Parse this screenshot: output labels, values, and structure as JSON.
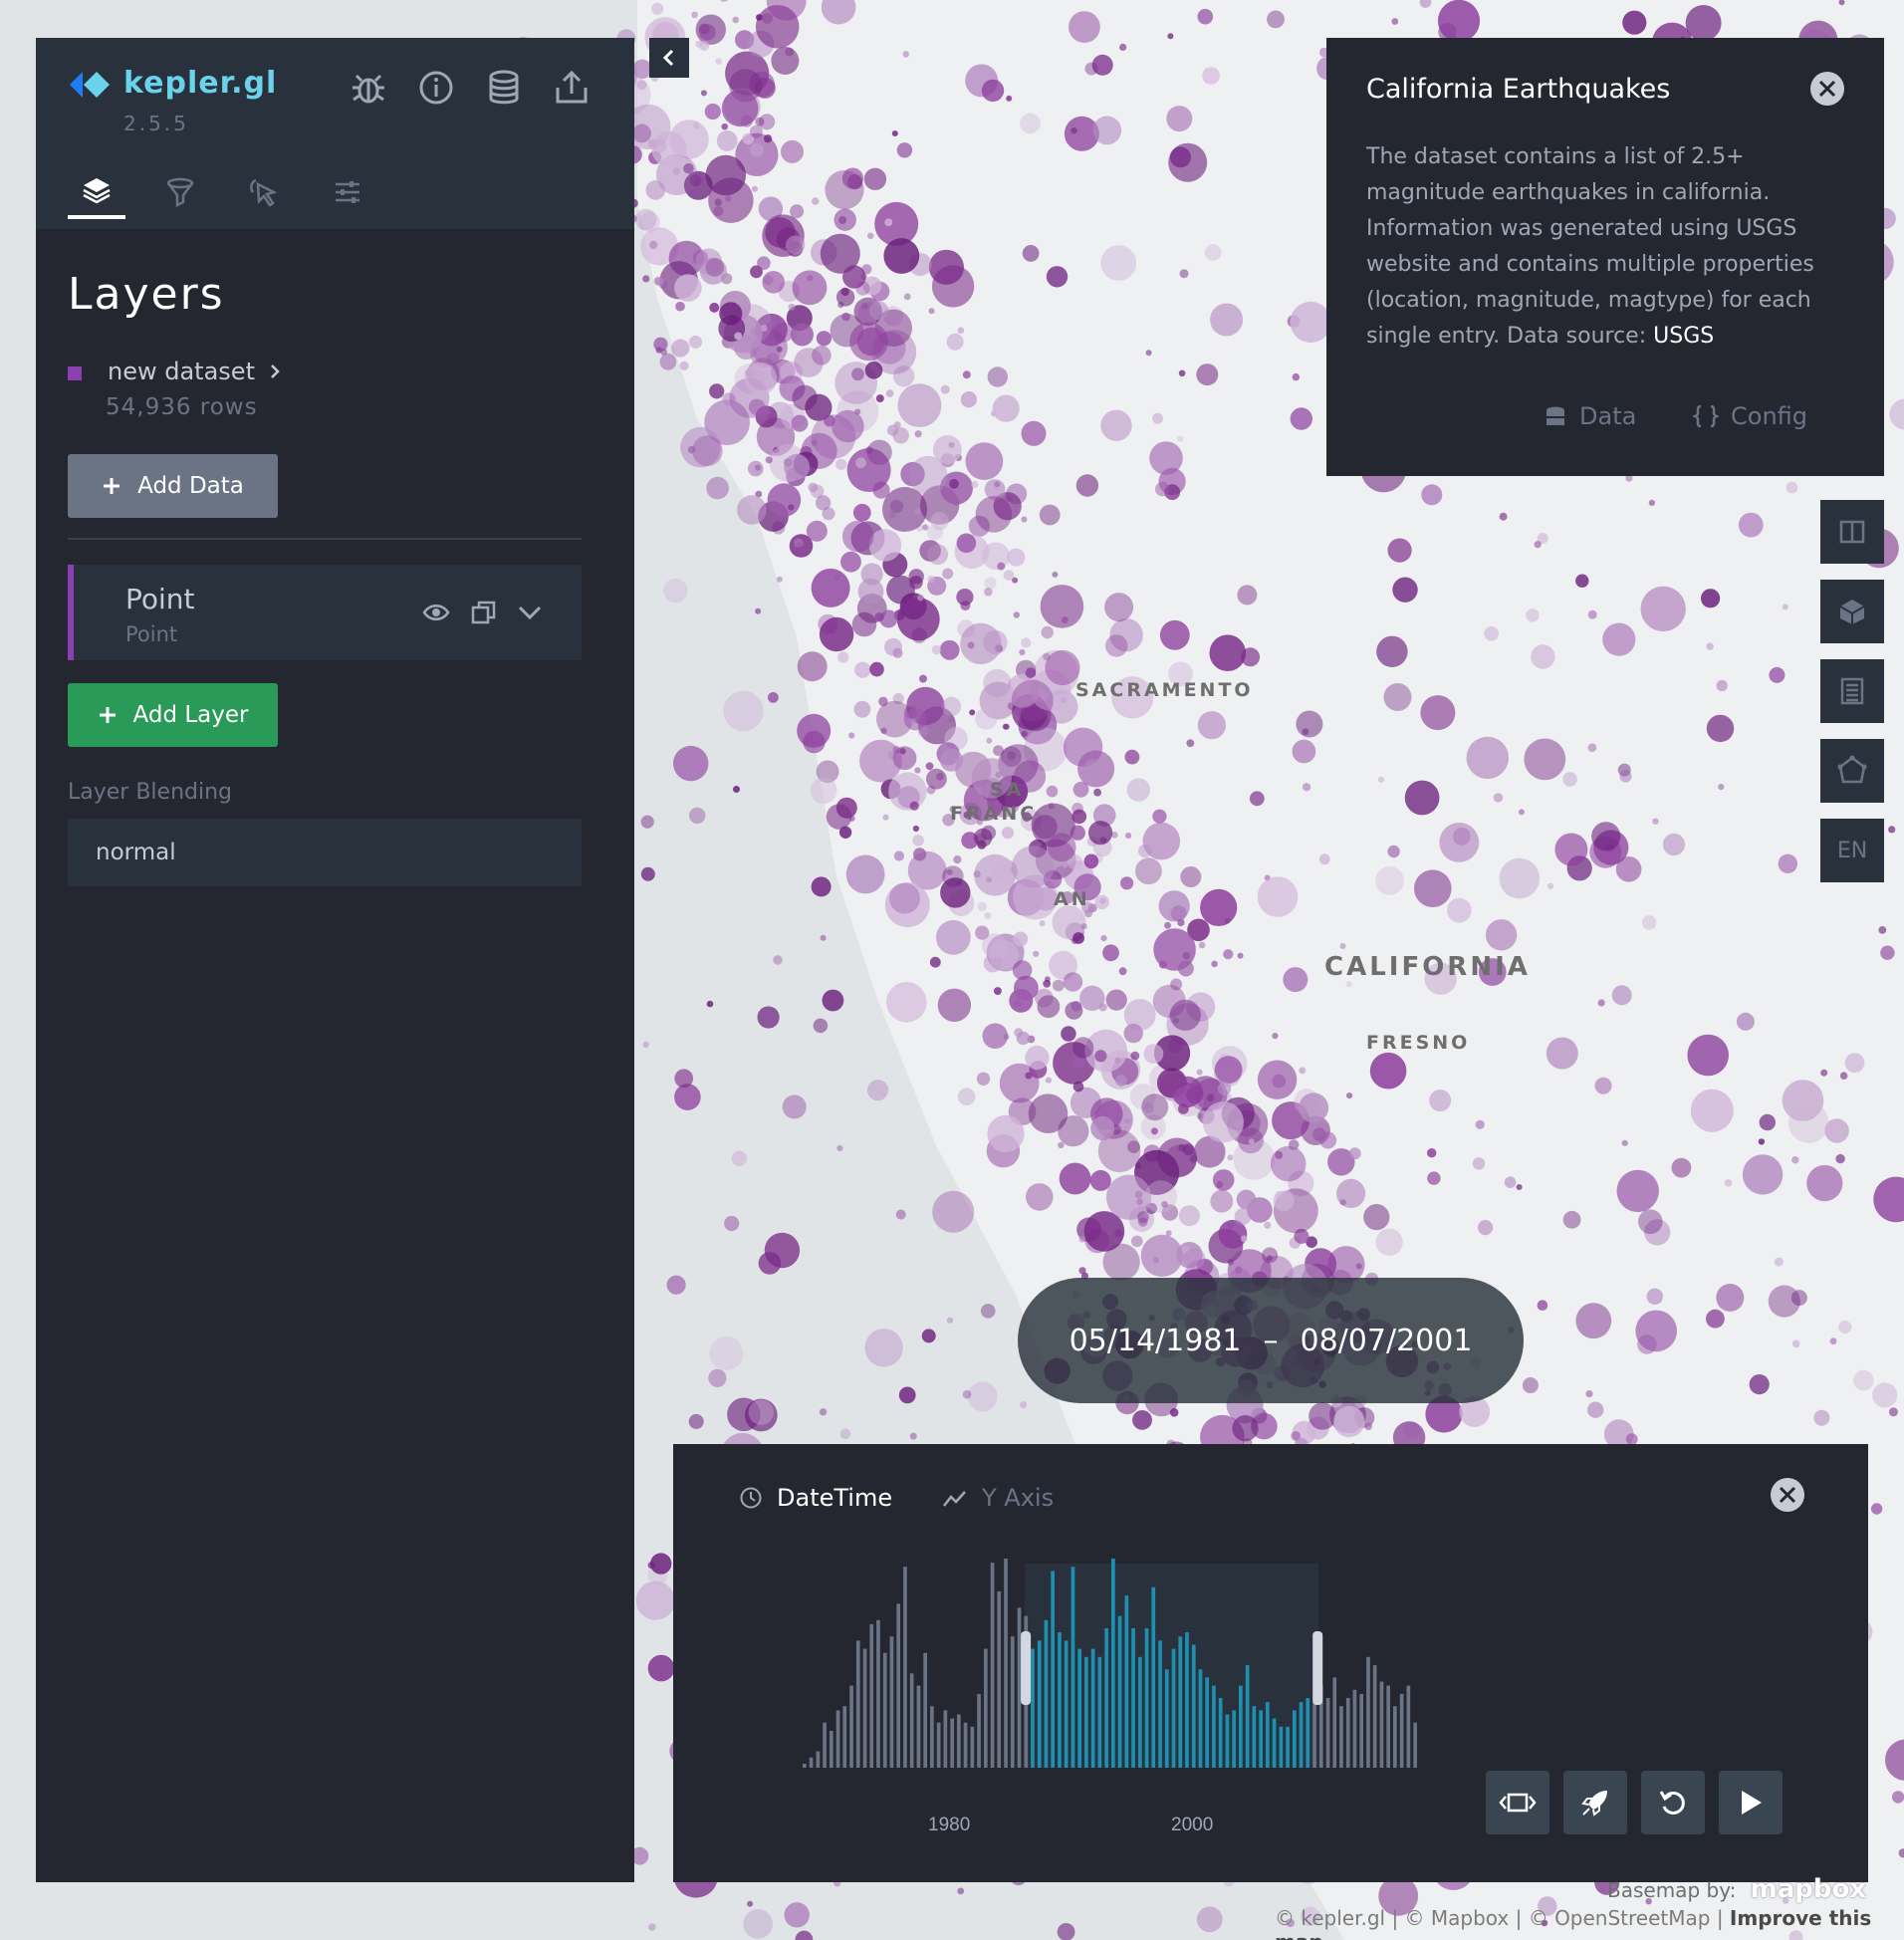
{
  "app": {
    "logo_text": "kepler.gl",
    "version": "2.5.5"
  },
  "side_panel": {
    "title": "Layers",
    "dataset": {
      "name": "new dataset",
      "rows": "54,936 rows",
      "color": "#8b3fb0"
    },
    "add_data_label": "Add Data",
    "layer": {
      "name": "Point",
      "type": "Point",
      "color": "#8b3fb0"
    },
    "add_layer_label": "Add Layer",
    "blending_label": "Layer Blending",
    "blending_value": "normal",
    "tabs": [
      "layers-icon",
      "filter-icon",
      "interaction-icon",
      "map-settings-icon"
    ],
    "header_icons": [
      "bug-icon",
      "info-icon",
      "database-icon",
      "share-icon"
    ]
  },
  "map": {
    "labels": [
      "SACRAMENTO",
      "CALIFORNIA",
      "FRESNO",
      "SA",
      "FRANC",
      "AN"
    ],
    "point_color": "#7a2a88"
  },
  "info_panel": {
    "title": "California Earthquakes",
    "description": "The dataset contains a list of 2.5+ magnitude earthquakes in california. Information was generated using USGS website and contains multiple properties (location, magnitude, magtype) for each single entry. Data source: ",
    "source_link": "USGS",
    "data_button": "Data",
    "config_button": "Config"
  },
  "map_controls": {
    "locale": "EN"
  },
  "time_filter": {
    "start": "05/14/1981",
    "separator": "–",
    "end": "08/07/2001",
    "field_label": "DateTime",
    "y_axis_label": "Y Axis",
    "tick_1980": "1980",
    "tick_2000": "2000"
  },
  "chart_data": {
    "type": "bar",
    "xlabel": "DateTime",
    "ylabel": "",
    "x_ticks": [
      "1980",
      "2000"
    ],
    "selected_range": [
      "05/14/1981",
      "08/07/2001"
    ],
    "values": [
      2,
      5,
      8,
      22,
      18,
      28,
      30,
      40,
      62,
      58,
      70,
      72,
      56,
      64,
      80,
      98,
      46,
      40,
      56,
      30,
      22,
      28,
      24,
      26,
      22,
      20,
      36,
      58,
      100,
      86,
      102,
      64,
      78,
      74,
      58,
      62,
      72,
      96,
      66,
      62,
      98,
      58,
      54,
      58,
      54,
      68,
      102,
      74,
      84,
      68,
      54,
      68,
      88,
      62,
      48,
      58,
      64,
      66,
      60,
      48,
      44,
      40,
      34,
      26,
      28,
      40,
      50,
      30,
      28,
      32,
      24,
      20,
      20,
      28,
      32,
      34,
      32,
      40,
      34,
      44,
      30,
      34,
      38,
      36,
      54,
      50,
      42,
      40,
      30,
      36,
      40,
      22
    ],
    "selected_color": "#1d8fb0",
    "unselected_color": "#6a7485"
  },
  "attribution": {
    "basemap_by": "Basemap by:",
    "mapbox": "mapbox",
    "credits": "© kepler.gl | © Mapbox | © OpenStreetMap | ",
    "improve": "Improve this map"
  }
}
